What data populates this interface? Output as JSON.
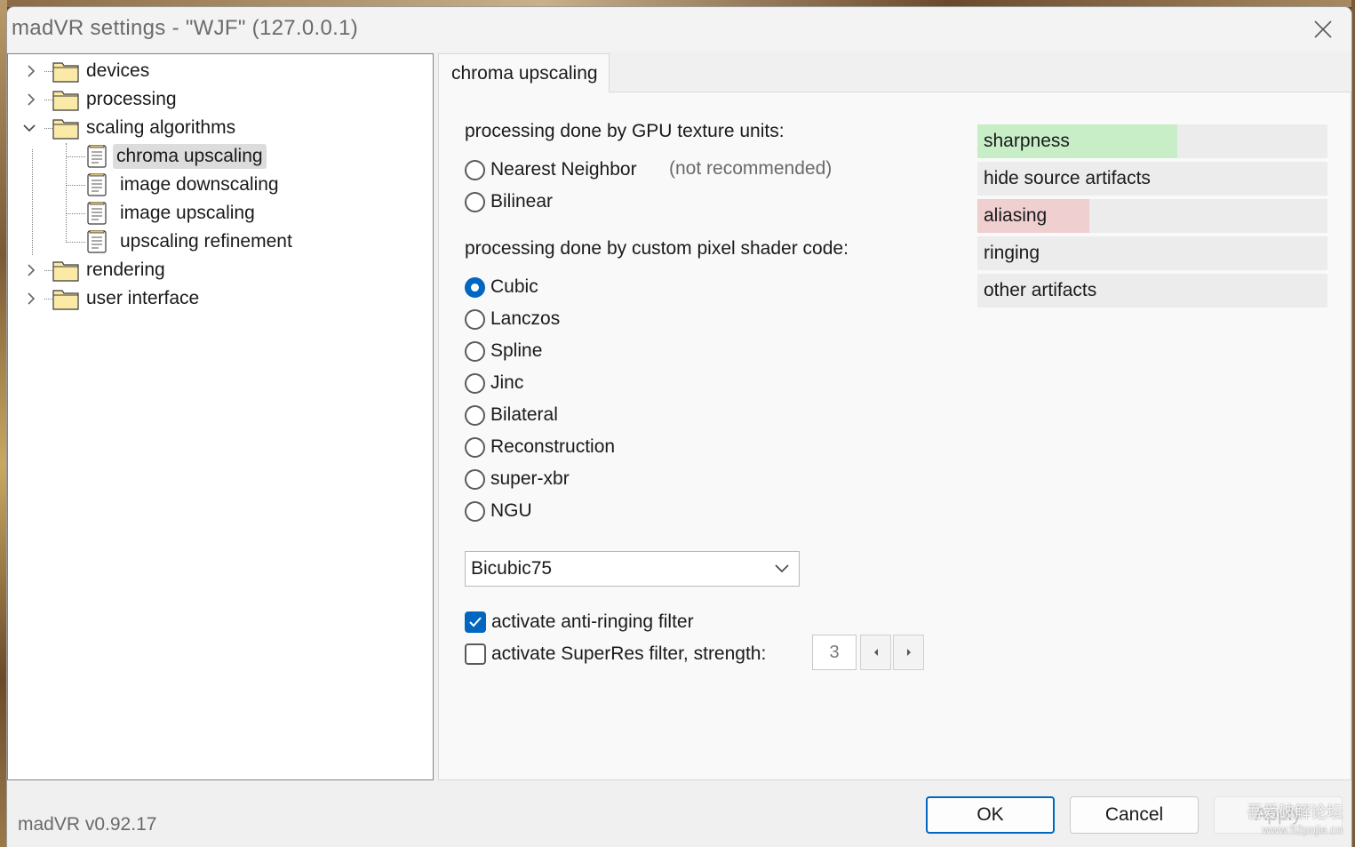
{
  "window": {
    "title": "madVR settings - \"WJF\" (127.0.0.1)",
    "version": "madVR v0.92.17"
  },
  "tree": {
    "items": [
      {
        "label": "devices",
        "expanded": false
      },
      {
        "label": "processing",
        "expanded": false
      },
      {
        "label": "scaling algorithms",
        "expanded": true,
        "children": [
          {
            "label": "chroma upscaling",
            "selected": true
          },
          {
            "label": "image downscaling"
          },
          {
            "label": "image upscaling"
          },
          {
            "label": "upscaling refinement"
          }
        ]
      },
      {
        "label": "rendering",
        "expanded": false
      },
      {
        "label": "user interface",
        "expanded": false
      }
    ]
  },
  "tab": {
    "label": "chroma upscaling"
  },
  "gpu_section": {
    "label": "processing done by GPU texture units:",
    "options": [
      {
        "label": "Nearest Neighbor",
        "hint": "(not recommended)",
        "checked": false
      },
      {
        "label": "Bilinear",
        "checked": false
      }
    ]
  },
  "shader_section": {
    "label": "processing done by custom pixel shader code:",
    "options": [
      {
        "label": "Cubic",
        "checked": true
      },
      {
        "label": "Lanczos",
        "checked": false
      },
      {
        "label": "Spline",
        "checked": false
      },
      {
        "label": "Jinc",
        "checked": false
      },
      {
        "label": "Bilateral",
        "checked": false
      },
      {
        "label": "Reconstruction",
        "checked": false
      },
      {
        "label": "super-xbr",
        "checked": false
      },
      {
        "label": "NGU",
        "checked": false
      }
    ]
  },
  "filter_select": {
    "value": "Bicubic75"
  },
  "anti_ringing": {
    "label": "activate anti-ringing filter",
    "checked": true
  },
  "superres": {
    "label": "activate SuperRes filter, strength:",
    "checked": false,
    "strength": "3"
  },
  "quality_meters": [
    {
      "label": "sharpness",
      "level": 0.57,
      "color": "#c8eec8"
    },
    {
      "label": "hide source artifacts",
      "level": 0.0,
      "color": "#c8eec8"
    },
    {
      "label": "aliasing",
      "level": 0.32,
      "color": "#f0cfd1"
    },
    {
      "label": "ringing",
      "level": 0.0,
      "color": "#f0cfd1"
    },
    {
      "label": "other artifacts",
      "level": 0.0,
      "color": "#c8eec8"
    }
  ],
  "buttons": {
    "ok": "OK",
    "cancel": "Cancel",
    "apply": "Apply"
  },
  "watermark": {
    "line1": "吾爱破解论坛",
    "line2": "www.52pojie.cn"
  },
  "colors": {
    "accent": "#0067c0",
    "selection": "#dcdcdc"
  }
}
